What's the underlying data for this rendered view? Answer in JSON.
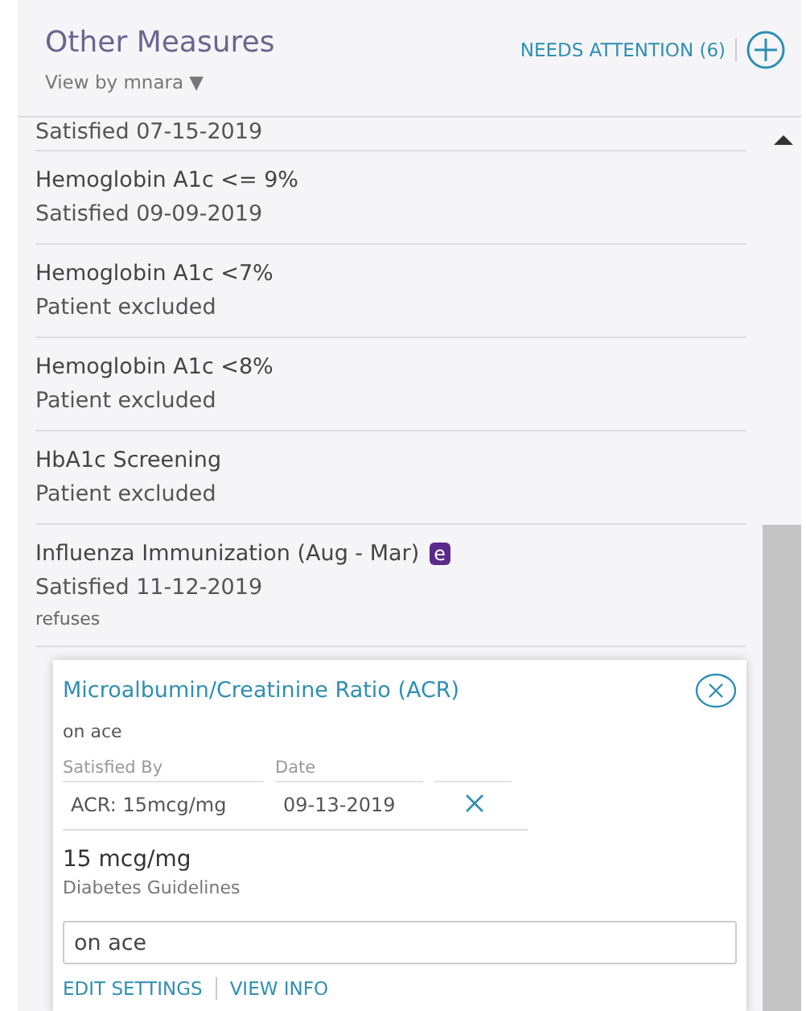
{
  "header": {
    "title": "Other Measures",
    "view_by": "View by mnara ▼",
    "needs_attention": "NEEDS ATTENTION (6)"
  },
  "measures": [
    {
      "status": "Satisfied 07-15-2019"
    },
    {
      "name": "Hemoglobin A1c <= 9%",
      "status": "Satisfied 09-09-2019"
    },
    {
      "name": "Hemoglobin A1c <7%",
      "status": "Patient excluded"
    },
    {
      "name": "Hemoglobin A1c <8%",
      "status": "Patient excluded"
    },
    {
      "name": "HbA1c Screening",
      "status": "Patient excluded"
    },
    {
      "name": "Influenza Immunization (Aug - Mar)",
      "status": "Satisfied 11-12-2019",
      "note": "refuses",
      "badge": "e"
    }
  ],
  "detail": {
    "title": "Microalbumin/Creatinine Ratio (ACR)",
    "note": "on ace",
    "columns": [
      "Satisfied By",
      "Date"
    ],
    "row": [
      "ACR: 15mcg/mg",
      "09-13-2019"
    ],
    "value": "15 mcg/mg",
    "source": "Diabetes Guidelines",
    "comment": "on ace",
    "links": [
      "EDIT SETTINGS",
      "VIEW INFO"
    ]
  }
}
